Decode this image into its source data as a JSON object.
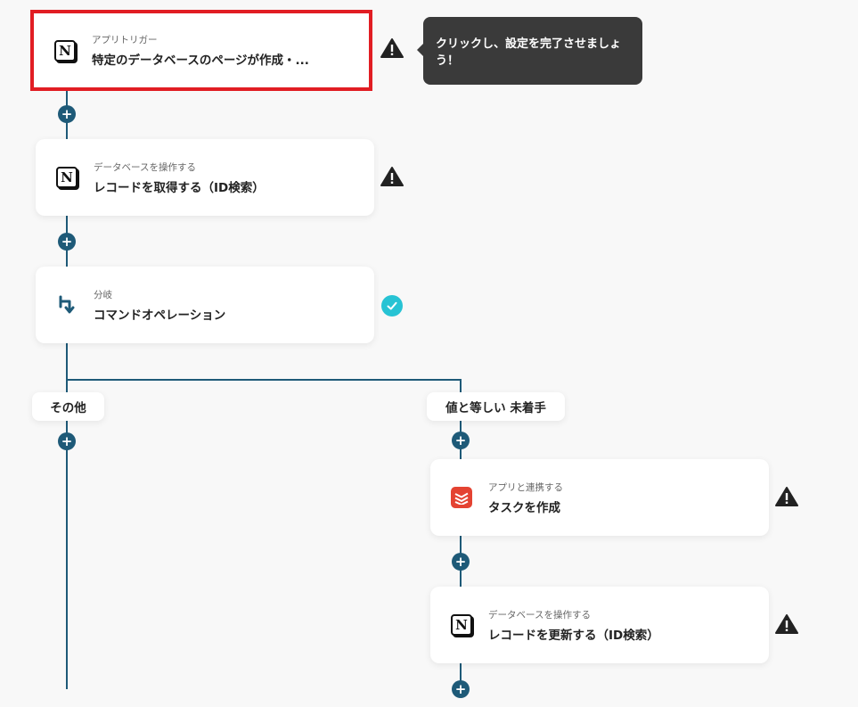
{
  "tooltip": {
    "text": "クリックし、設定を完了させましょう！"
  },
  "steps": [
    {
      "label": "アプリトリガー",
      "title": "特定のデータベースのページが作成・...",
      "icon": "notion-icon",
      "status": "warning"
    },
    {
      "label": "データベースを操作する",
      "title": "レコードを取得する（ID検索）",
      "icon": "notion-icon",
      "status": "warning"
    },
    {
      "label": "分岐",
      "title": "コマンドオペレーション",
      "icon": "branch-icon",
      "status": "complete"
    },
    {
      "label": "アプリと連携する",
      "title": "タスクを作成",
      "icon": "todoist-icon",
      "status": "warning"
    },
    {
      "label": "データベースを操作する",
      "title": "レコードを更新する（ID検索）",
      "icon": "notion-icon",
      "status": "warning"
    }
  ],
  "branches": [
    {
      "label": "その他"
    },
    {
      "label": "値と等しい 未着手"
    }
  ],
  "colors": {
    "line": "#1e5a78",
    "highlight": "#e11d23",
    "check": "#27c3d4",
    "tooltip_bg": "#3a3a3a"
  }
}
